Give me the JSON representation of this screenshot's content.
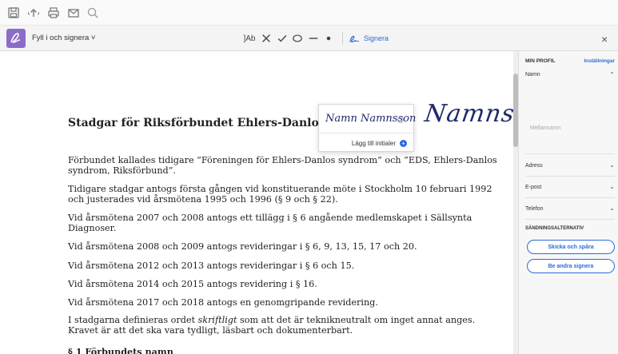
{
  "toolbar": {
    "icons": [
      "save-icon",
      "upload-icon",
      "print-icon",
      "email-icon",
      "search-icon"
    ]
  },
  "fill_sign": {
    "label": "Fyll i och signera ˅",
    "text_tool": "]Ab",
    "signera_label": "Signera",
    "close": "×"
  },
  "signature_menu": {
    "signature_text": "Namn Namnsson",
    "add_initials": "Lägg till initialer"
  },
  "document": {
    "title": "Stadgar för Riksförbundet Ehlers-Danlos syndrom",
    "placed_signature": "Namn Namnsson",
    "paragraphs": [
      "Förbundet kallades tidigare ”Föreningen för Ehlers-Danlos syndrom” och ”EDS, Ehlers-Danlos syndrom, Riksförbund”.",
      "Tidigare stadgar antogs första gången vid konstituerande möte i Stockholm 10 februari 1992 och justerades vid årsmötena 1995 och 1996 (§ 9 och § 22).",
      "Vid årsmötena 2007 och 2008 antogs ett tillägg i § 6 angående medlemskapet i Sällsynta Diagnoser.",
      "Vid årsmötena 2008 och 2009 antogs revideringar i § 6, 9, 13, 15, 17 och 20.",
      "Vid årsmötena 2012 och 2013 antogs revideringar i § 6 och 15.",
      "Vid årsmötena 2014 och 2015 antogs revidering i § 16.",
      "Vid årsmötena 2017 och 2018 antogs en genomgripande revidering."
    ],
    "skriftligt_pre": "I stadgarna definieras ordet ",
    "skriftligt_word": "skriftligt",
    "skriftligt_post": " som att det är teknikneutralt om inget annat anges. Kravet är att det ska vara tydligt, läsbart och dokumenterbart.",
    "section_heading": "§ 1 Förbundets namn"
  },
  "panel": {
    "heading": "MIN PROFIL",
    "settings": "Inställningar",
    "name_label": "Namn",
    "middle_name_placeholder": "Mellannamn",
    "address_label": "Adress",
    "email_label": "E-post",
    "phone_label": "Telefon",
    "send_options": "SÄNDNINGSALTERNATIV",
    "send_track": "Skicka och spåra",
    "ask_others": "Be andra signera"
  },
  "colors": {
    "accent": "#2d6bd6",
    "fill_sign_logo": "#8b6cc7",
    "signature_ink": "#1f2a6b"
  }
}
